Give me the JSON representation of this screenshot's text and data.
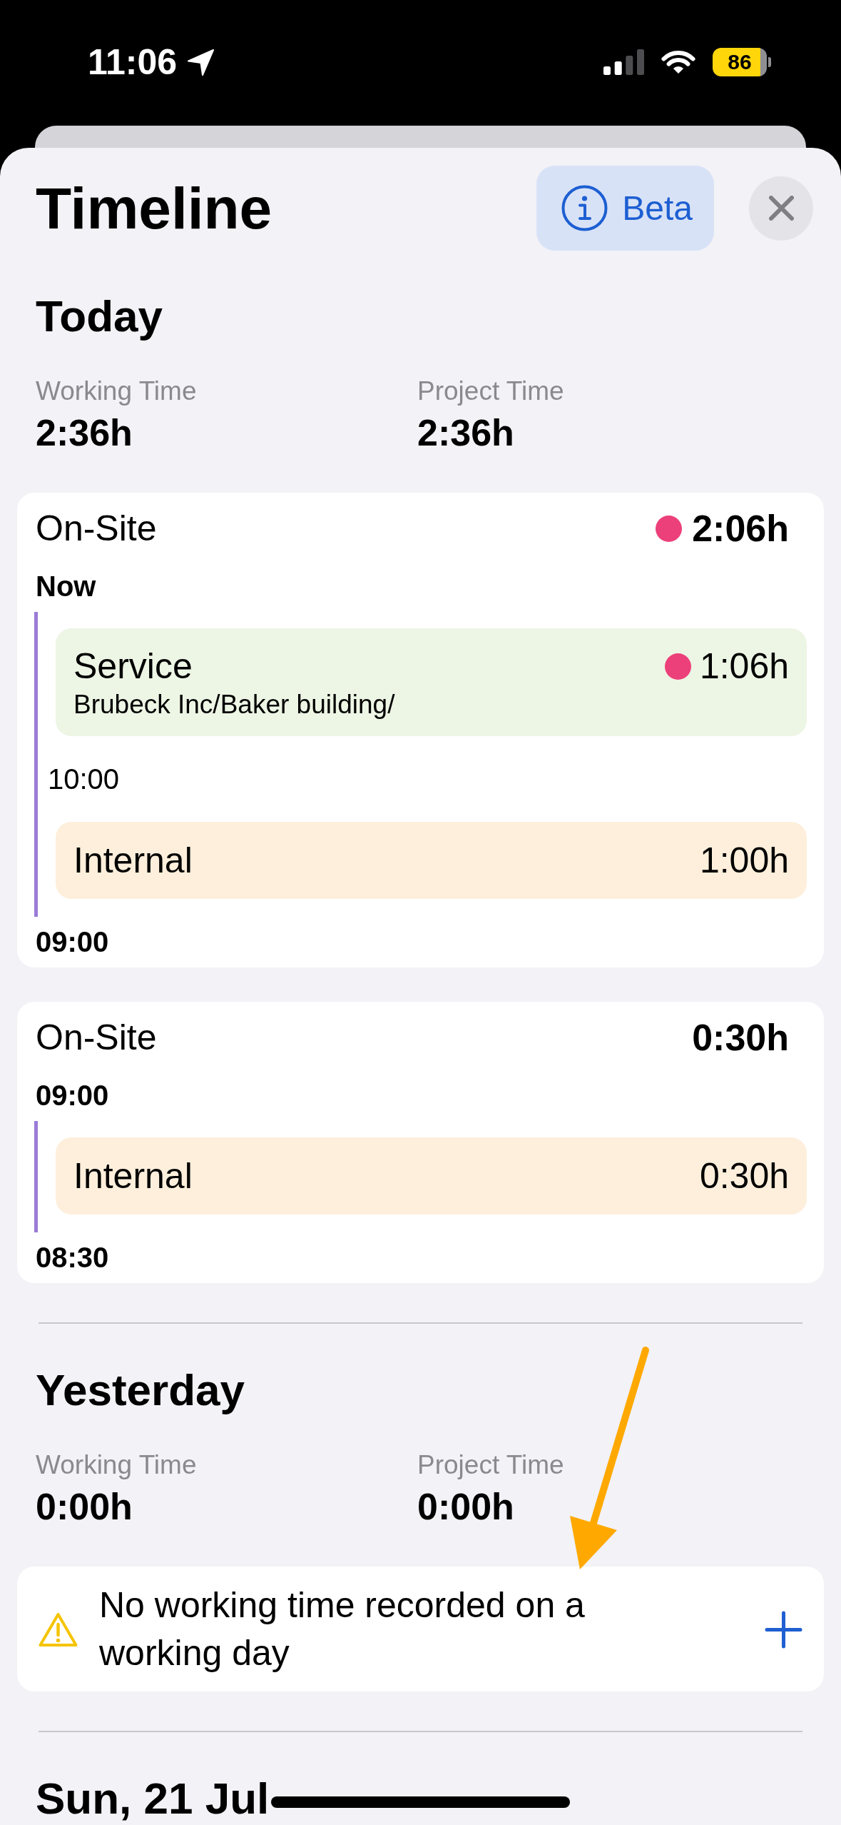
{
  "status_bar": {
    "time": "11:06",
    "battery": "86"
  },
  "header": {
    "title": "Timeline",
    "beta_button": "Beta"
  },
  "days": [
    {
      "title": "Today",
      "stats": [
        {
          "label": "Working Time",
          "value": "2:36h"
        },
        {
          "label": "Project Time",
          "value": "2:36h"
        }
      ],
      "cards": [
        {
          "kind": "session",
          "title": "On-Site",
          "total": "2:06h",
          "running": true,
          "top_label": "Now",
          "bottom_label": "09:00",
          "items": [
            {
              "kind": "entry",
              "title": "Service",
              "path": "Brubeck Inc/Baker building/",
              "duration": "1:06h",
              "running": true,
              "color": "#edf5e4"
            },
            {
              "kind": "marker",
              "time": "10:00"
            },
            {
              "kind": "entry",
              "title": "Internal",
              "duration": "1:00h",
              "running": false,
              "color": "#fdefdb"
            }
          ]
        },
        {
          "kind": "session",
          "title": "On-Site",
          "total": "0:30h",
          "running": false,
          "top_label": "09:00",
          "bottom_label": "08:30",
          "items": [
            {
              "kind": "entry",
              "title": "Internal",
              "duration": "0:30h",
              "running": false,
              "color": "#fdefdb"
            }
          ]
        }
      ]
    },
    {
      "title": "Yesterday",
      "stats": [
        {
          "label": "Working Time",
          "value": "0:00h"
        },
        {
          "label": "Project Time",
          "value": "0:00h"
        }
      ],
      "cards": [
        {
          "kind": "warning",
          "message": "No working time recorded on a working day"
        }
      ]
    },
    {
      "title": "Sun, 21 Jul"
    }
  ]
}
